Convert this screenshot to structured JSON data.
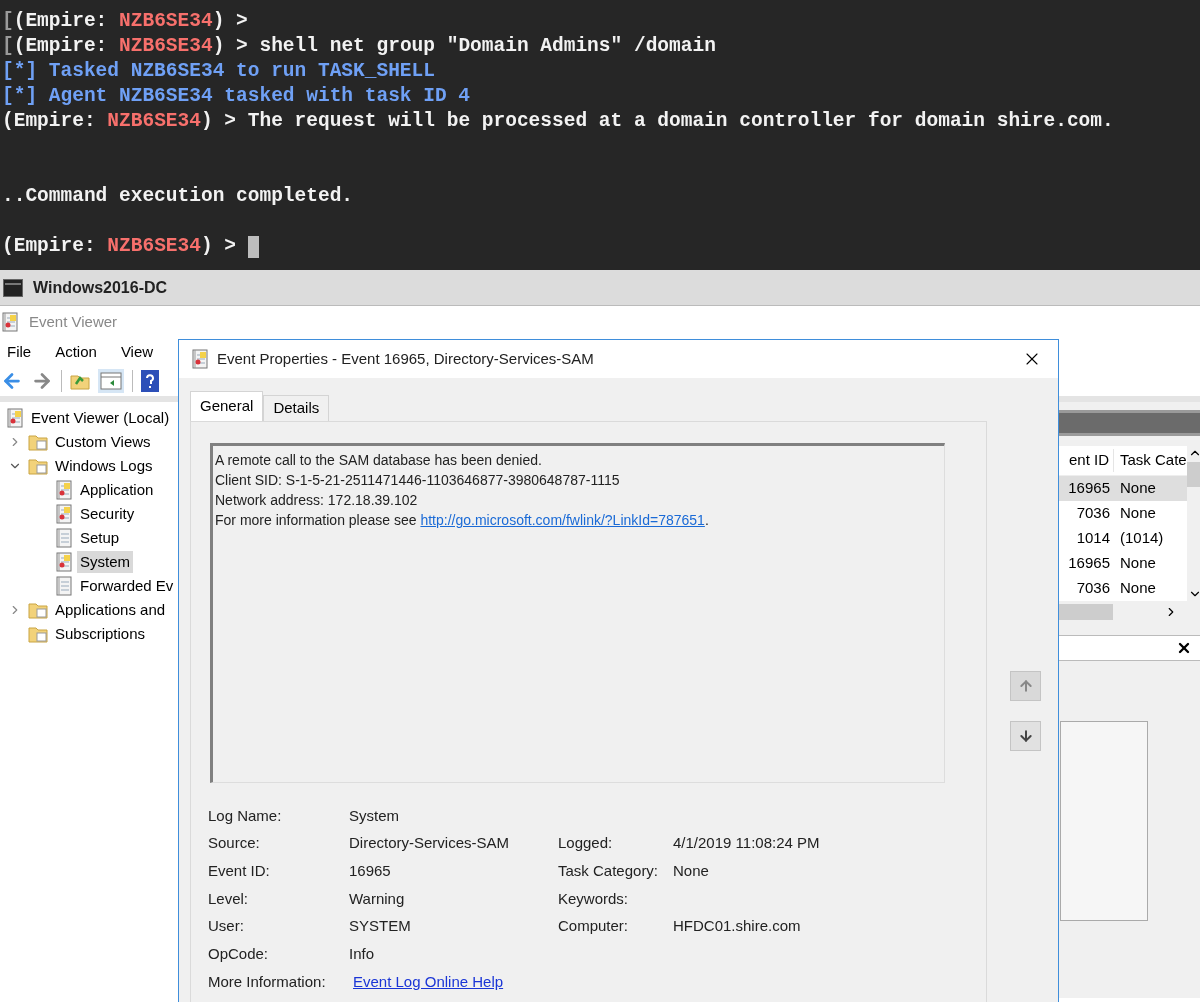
{
  "terminal": {
    "lines": [
      {
        "kind": "line",
        "parts": [
          {
            "text": "[",
            "color": "#9a9a9a"
          },
          {
            "text": "(Empire: ",
            "color": "#f2f2f2"
          },
          {
            "text": "NZB6SE34",
            "color": "#f7706c"
          },
          {
            "text": ") >",
            "color": "#f2f2f2"
          }
        ]
      },
      {
        "kind": "line",
        "parts": [
          {
            "text": "[",
            "color": "#9a9a9a"
          },
          {
            "text": "(Empire: ",
            "color": "#f2f2f2"
          },
          {
            "text": "NZB6SE34",
            "color": "#f7706c"
          },
          {
            "text": ") > shell net group \"Domain Admins\" /domain",
            "color": "#f2f2f2"
          }
        ]
      },
      {
        "kind": "line",
        "parts": [
          {
            "text": "[*] Tasked NZB6SE34 to run TASK_SHELL",
            "color": "#6fa0f5"
          }
        ]
      },
      {
        "kind": "line",
        "parts": [
          {
            "text": "[*] Agent NZB6SE34 tasked with task ID 4",
            "color": "#6fa0f5"
          }
        ]
      },
      {
        "kind": "line",
        "parts": [
          {
            "text": "(Empire: ",
            "color": "#f2f2f2"
          },
          {
            "text": "NZB6SE34",
            "color": "#f7706c"
          },
          {
            "text": ") > The request will be processed at a domain controller for domain shire.com.",
            "color": "#f2f2f2"
          }
        ]
      },
      {
        "kind": "blank"
      },
      {
        "kind": "blank"
      },
      {
        "kind": "line",
        "parts": [
          {
            "text": "..Command execution completed.",
            "color": "#f2f2f2"
          }
        ]
      },
      {
        "kind": "blank"
      },
      {
        "kind": "line",
        "cursor": true,
        "parts": [
          {
            "text": "(Empire: ",
            "color": "#f2f2f2"
          },
          {
            "text": "NZB6SE34",
            "color": "#f7706c"
          },
          {
            "text": ") >",
            "color": "#f2f2f2"
          }
        ]
      }
    ]
  },
  "host_window": {
    "title": "Windows2016-DC"
  },
  "event_viewer": {
    "title": "Event Viewer",
    "menu": [
      "File",
      "Action",
      "View"
    ],
    "tree": [
      {
        "label": "Event Viewer (Local)",
        "kind": "viewer",
        "selected": false,
        "children": [
          {
            "label": "Custom Views",
            "kind": "folder",
            "selected": false,
            "expanded": false
          },
          {
            "label": "Windows Logs",
            "kind": "folder",
            "selected": false,
            "expanded": true,
            "children": [
              {
                "label": "Application",
                "kind": "log",
                "selected": false
              },
              {
                "label": "Security",
                "kind": "log",
                "selected": false
              },
              {
                "label": "Setup",
                "kind": "plain-log",
                "selected": false
              },
              {
                "label": "System",
                "kind": "log",
                "selected": true
              },
              {
                "label": "Forwarded Ev",
                "kind": "plain-log",
                "selected": false
              }
            ]
          },
          {
            "label": "Applications and",
            "kind": "folder",
            "selected": false,
            "expanded": false
          },
          {
            "label": "Subscriptions",
            "kind": "folder",
            "selected": false
          }
        ]
      }
    ],
    "table": {
      "columns": [
        "ent ID",
        "Task Cate"
      ],
      "rows": [
        {
          "cells": [
            "16965",
            "None"
          ],
          "selected": true
        },
        {
          "cells": [
            "7036",
            "None"
          ],
          "selected": false
        },
        {
          "cells": [
            "1014",
            "(1014)"
          ],
          "selected": false
        },
        {
          "cells": [
            "16965",
            "None"
          ],
          "selected": false
        },
        {
          "cells": [
            "7036",
            "None"
          ],
          "selected": false
        }
      ]
    }
  },
  "dialog": {
    "title": "Event Properties - Event 16965, Directory-Services-SAM",
    "tabs": [
      {
        "label": "General",
        "selected": true
      },
      {
        "label": "Details",
        "selected": false
      }
    ],
    "description": {
      "lines": [
        "A remote call to the SAM database has been denied.",
        "Client SID: S-1-5-21-2511471446-1103646877-3980648787-1115",
        "Network address: 172.18.39.102"
      ],
      "more_info": {
        "text": "For more information please see",
        "link": "http://go.microsoft.com/fwlink/?LinkId=787651",
        "tail": "."
      }
    },
    "fields": [
      {
        "label": "Log Name:",
        "value": "System"
      },
      {
        "label": "Source:",
        "value": "Directory-Services-SAM",
        "label_2": "Logged:",
        "value_2": "4/1/2019 11:08:24 PM"
      },
      {
        "label": "Event ID:",
        "value": "16965",
        "label_2": "Task Category:",
        "value_2": "None"
      },
      {
        "label": "Level:",
        "value": "Warning",
        "label_2": "Keywords:"
      },
      {
        "label": "User:",
        "value": "SYSTEM",
        "label_2": "Computer:",
        "value_2": "HFDC01.shire.com"
      },
      {
        "label": "OpCode:",
        "value": "Info"
      },
      {
        "label": "More Information:",
        "value": "Event Log Online Help",
        "kind": "link"
      }
    ]
  }
}
